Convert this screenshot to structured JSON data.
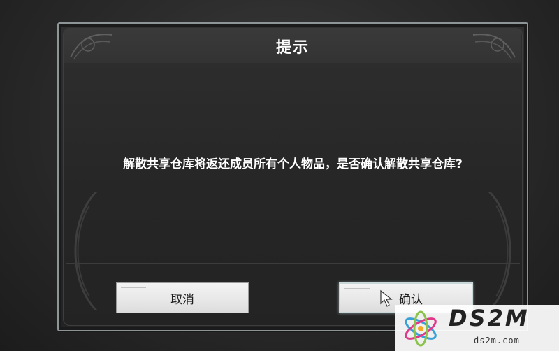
{
  "dialog": {
    "title": "提示",
    "message": "解散共享仓库将返还成员所有个人物品，是否确认解散共享仓库?"
  },
  "buttons": {
    "cancel_label": "取消",
    "confirm_label": "确认"
  },
  "watermark": {
    "brand": "DS2M",
    "domain": "ds2m.com"
  },
  "colors": {
    "panel_border": "#8d9596",
    "panel_bg": "#2a2a2a",
    "button_bg": "#ececec",
    "text": "#ffffff"
  },
  "icons": {
    "cursor": "pointer-cursor-icon",
    "logo": "atom-logo-icon"
  }
}
